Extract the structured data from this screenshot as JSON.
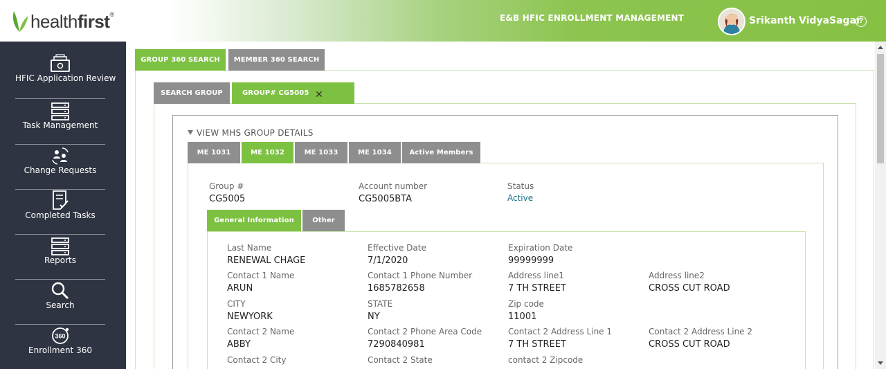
{
  "header": {
    "logo_text_plain": "health",
    "logo_text_bold": "first",
    "logo_reg": "®",
    "app_title": "E&B HFIC ENROLLMENT MANAGEMENT",
    "user_name": "Srikanth VidyaSagar",
    "help_icon": "question-circle-icon",
    "help_glyph": "?"
  },
  "sidebar": {
    "items": [
      {
        "label": "HFIC Application Review",
        "icon": "inbox-icon"
      },
      {
        "label": "Task Management",
        "icon": "server-stack-icon"
      },
      {
        "label": "Change Requests",
        "icon": "people-swap-icon"
      },
      {
        "label": "Completed Tasks",
        "icon": "checklist-icon"
      },
      {
        "label": "Reports",
        "icon": "server-stack-icon"
      },
      {
        "label": "Search",
        "icon": "search-icon"
      },
      {
        "label": "Enrollment 360",
        "icon": "circle-360-icon"
      }
    ],
    "badge_360": "360"
  },
  "top_tabs": [
    {
      "label": "GROUP 360 SEARCH",
      "active": true
    },
    {
      "label": "MEMBER 360 SEARCH",
      "active": false
    }
  ],
  "sub_tabs": [
    {
      "label": "SEARCH GROUP",
      "active": false
    },
    {
      "label": "GROUP# CG5005",
      "active": true
    }
  ],
  "close_glyph": "✕",
  "mhs": {
    "heading": "VIEW MHS GROUP DETAILS",
    "tabs": [
      {
        "label": "ME 1031",
        "active": false
      },
      {
        "label": "ME 1032",
        "active": true
      },
      {
        "label": "ME 1033",
        "active": false
      },
      {
        "label": "ME 1034",
        "active": false
      },
      {
        "label": "Active Members",
        "active": false
      }
    ]
  },
  "summary": {
    "group_label": "Group #",
    "group_value": "CG5005",
    "account_label": "Account number",
    "account_value": "CG5005BTA",
    "status_label": "Status",
    "status_value": "Active"
  },
  "info_tabs": [
    {
      "label": "General Information",
      "active": true
    },
    {
      "label": "Other",
      "active": false
    }
  ],
  "fields": [
    {
      "label": "Last Name",
      "value": "RENEWAL CHAGE"
    },
    {
      "label": "Effective Date",
      "value": "7/1/2020"
    },
    {
      "label": "Expiration Date",
      "value": "99999999"
    },
    {
      "label": "Contact 1 Name",
      "value": "ARUN"
    },
    {
      "label": "Contact 1 Phone Number",
      "value": "1685782658"
    },
    {
      "label": "Address line1",
      "value": "7 TH STREET"
    },
    {
      "label": "Address line2",
      "value": "CROSS CUT ROAD"
    },
    {
      "label": "CITY",
      "value": "NEWYORK"
    },
    {
      "label": "STATE",
      "value": "NY"
    },
    {
      "label": "Zip code",
      "value": "11001"
    },
    {
      "label": "Contact 2 Name",
      "value": "ABBY"
    },
    {
      "label": "Contact 2 Phone Area Code",
      "value": "7290840981"
    },
    {
      "label": "Contact 2 Address Line 1",
      "value": "7 TH STREET"
    },
    {
      "label": "Contact 2 Address Line 2",
      "value": "CROSS CUT ROAD"
    },
    {
      "label": "Contact 2 City",
      "value": ""
    },
    {
      "label": "Contact 2 State",
      "value": ""
    },
    {
      "label": "contact 2 Zipcode",
      "value": ""
    }
  ],
  "colors": {
    "brand_green": "#7dc142",
    "tab_gray": "#8e8e8e",
    "sidebar_bg": "#2f3442",
    "status_blue": "#1a6e8a"
  }
}
